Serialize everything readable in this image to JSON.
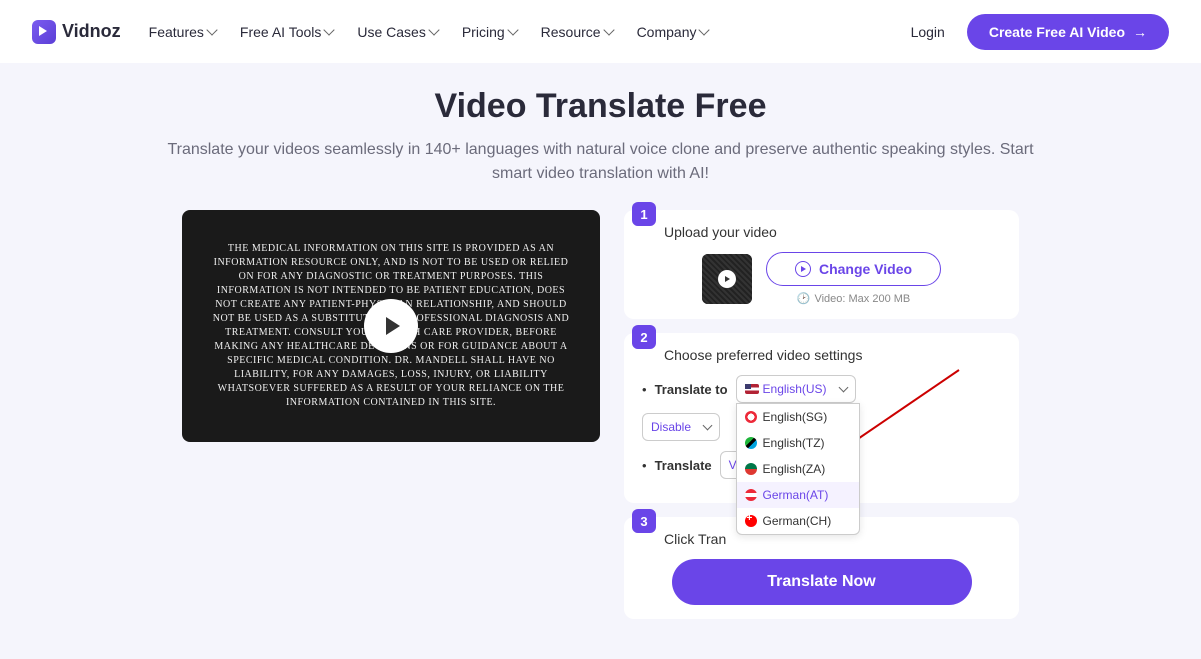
{
  "header": {
    "logo": "Vidnoz",
    "nav": [
      "Features",
      "Free AI Tools",
      "Use Cases",
      "Pricing",
      "Resource",
      "Company"
    ],
    "login": "Login",
    "cta": "Create Free AI Video"
  },
  "hero": {
    "title": "Video Translate Free",
    "subtitle": "Translate your videos seamlessly in 140+ languages with natural voice clone and preserve authentic speaking styles. Start smart video translation with AI!"
  },
  "video": {
    "text": "The medical information on this site is provided as an information resource only, and is not to be used or relied on for any diagnostic or treatment purposes. This information is not intended to be patient education, does not create any patient-physician relationship, and should not be used as a substitute for professional diagnosis and treatment. Consult your health care provider, before making any healthcare decisions or for guidance about a specific medical condition. Dr. Mandell shall have no liability, for any damages, loss, injury, or liability whatsoever suffered as a result of your reliance on the information contained in this site."
  },
  "steps": {
    "s1": {
      "num": "1",
      "label": "Upload your video",
      "change": "Change Video",
      "hint": "Video: Max 200 MB"
    },
    "s2": {
      "num": "2",
      "label": "Choose preferred video settings",
      "translate_to": "Translate to",
      "selected_lang": "English(US)",
      "disable": "Disable",
      "translate": "Translate",
      "translate_val": "V",
      "options": [
        {
          "label": "English(SG)",
          "flag": "sg"
        },
        {
          "label": "English(TZ)",
          "flag": "tz"
        },
        {
          "label": "English(ZA)",
          "flag": "za"
        },
        {
          "label": "German(AT)",
          "flag": "at",
          "highlight": true
        },
        {
          "label": "German(CH)",
          "flag": "ch"
        }
      ]
    },
    "s3": {
      "num": "3",
      "label": "Click Tran",
      "btn": "Translate Now"
    }
  }
}
